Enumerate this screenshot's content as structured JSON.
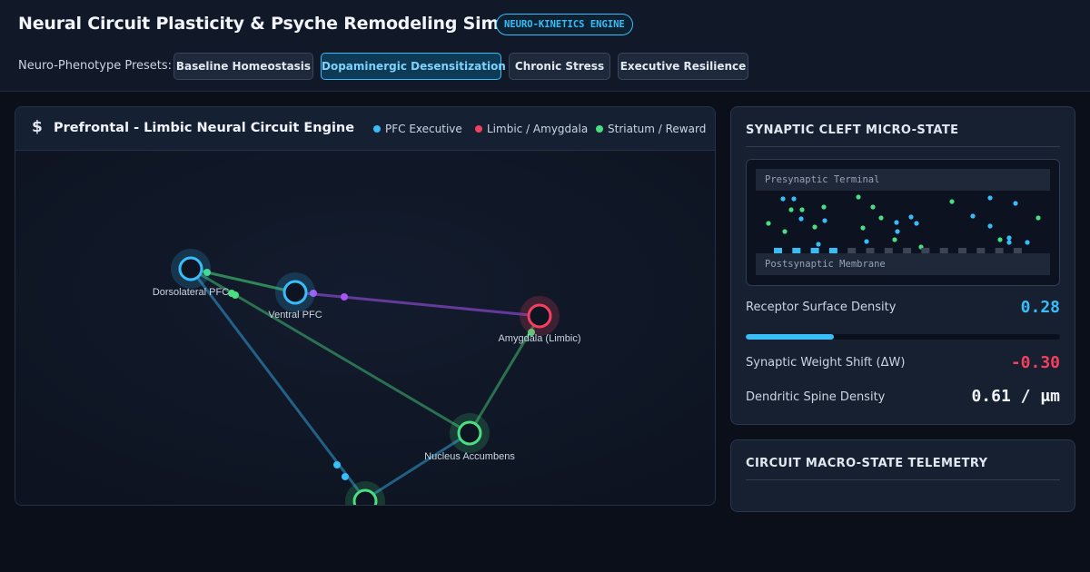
{
  "header": {
    "title": "Neural Circuit Plasticity & Psyche Remodeling Simulator",
    "badge": "NEURO-KINETICS ENGINE",
    "presets_label": "Neuro-Phenotype Presets:",
    "presets": [
      {
        "label": "Baseline Homeostasis",
        "active": false
      },
      {
        "label": "Dopaminergic Desensitization",
        "active": true
      },
      {
        "label": "Chronic Stress",
        "active": false
      },
      {
        "label": "Executive Resilience",
        "active": false
      }
    ]
  },
  "circuit": {
    "icon": "dollar-icon",
    "title": "Prefrontal - Limbic Neural Circuit Engine",
    "legend": [
      {
        "label": "PFC Executive",
        "color": "#38bdf8"
      },
      {
        "label": "Limbic / Amygdala",
        "color": "#f43f5e"
      },
      {
        "label": "Striatum / Reward",
        "color": "#4ade80"
      }
    ],
    "nodes": [
      {
        "label": "Dorsolateral PFC",
        "group": "pfc"
      },
      {
        "label": "Ventral PFC",
        "group": "pfc"
      },
      {
        "label": "Amygdala (Limbic)",
        "group": "limbic"
      },
      {
        "label": "Nucleus Accumbens",
        "group": "striatum"
      },
      {
        "label": "",
        "group": "striatum"
      }
    ],
    "colors": {
      "pfc": "#38bdf8",
      "limbic": "#f43f5e",
      "striatum": "#4ade80",
      "signal": "#a855f7"
    }
  },
  "synaptic": {
    "title": "SYNAPTIC CLEFT MICRO-STATE",
    "presynaptic_label": "Presynaptic Terminal",
    "postsynaptic_label": "Postsynaptic Membrane",
    "active_receptors": 4,
    "total_receptors": 14,
    "metrics": {
      "receptor_density_label": "Receptor Surface Density",
      "receptor_density_value": "0.28",
      "receptor_density_fraction": 0.28,
      "weight_shift_label": "Synaptic Weight Shift (ΔW)",
      "weight_shift_value": "-0.30",
      "spine_density_label": "Dendritic Spine Density",
      "spine_density_value": "0.61 / μm"
    },
    "colors": {
      "density": "#38bdf8",
      "shift": "#f43f5e",
      "spine": "#f1f5f9"
    }
  },
  "macro": {
    "title": "CIRCUIT MACRO-STATE TELEMETRY"
  }
}
